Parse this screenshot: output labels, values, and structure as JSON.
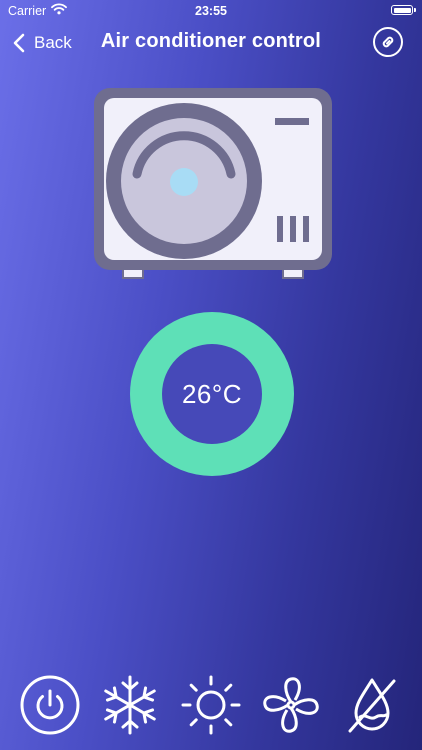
{
  "status_bar": {
    "carrier": "Carrier",
    "time": "23:55",
    "wifi_icon": "wifi-icon",
    "battery_icon": "battery-icon"
  },
  "nav": {
    "back_label": "Back",
    "title": "Air conditioner control",
    "link_icon": "link-icon"
  },
  "device": {
    "illustration": "air-conditioner-outdoor-unit-icon"
  },
  "temperature": {
    "value": "26°C",
    "ring_color": "#5ee0b7"
  },
  "modes": [
    {
      "name": "power",
      "icon": "power-icon"
    },
    {
      "name": "cool",
      "icon": "snowflake-icon"
    },
    {
      "name": "heat",
      "icon": "sun-icon"
    },
    {
      "name": "fan",
      "icon": "fan-icon"
    },
    {
      "name": "dry",
      "icon": "drop-slash-icon"
    }
  ],
  "colors": {
    "background_start": "#6b6fe8",
    "background_end": "#24257a",
    "accent": "#5ee0b7",
    "unit_body": "#f1f0fa",
    "unit_frame": "#6f6d8f"
  }
}
